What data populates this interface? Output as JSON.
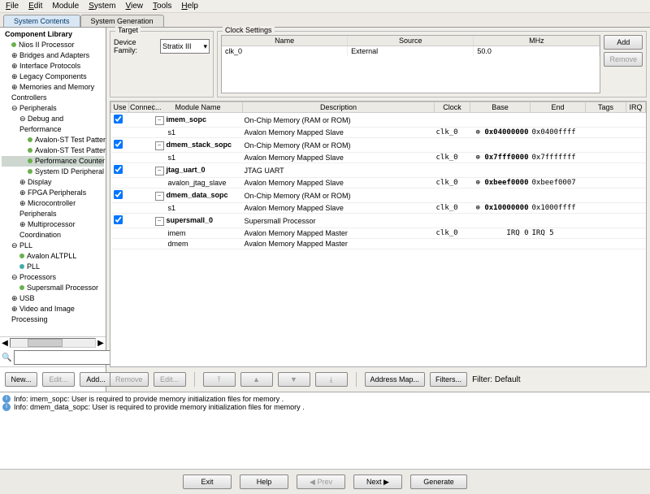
{
  "menu": {
    "file": "File",
    "edit": "Edit",
    "module": "Module",
    "system": "System",
    "view": "View",
    "tools": "Tools",
    "help": "Help"
  },
  "tabs": {
    "contents": "System Contents",
    "generation": "System Generation"
  },
  "target": {
    "legend": "Target",
    "label": "Device Family:",
    "value": "Stratix III"
  },
  "clock": {
    "legend": "Clock Settings",
    "hdr_name": "Name",
    "hdr_source": "Source",
    "hdr_mhz": "MHz",
    "row": {
      "name": "clk_0",
      "source": "External",
      "mhz": "50.0"
    },
    "add": "Add",
    "remove": "Remove"
  },
  "tree": {
    "lib": "Component Library",
    "items": [
      "Nios II Processor",
      "Bridges and Adapters",
      "Interface Protocols",
      "Legacy Components",
      "Memories and Memory Controllers",
      "Peripherals",
      "Debug and Performance",
      "Avalon-ST Test Pattern",
      "Avalon-ST Test Pattern",
      "Performance Counter",
      "System ID Peripheral",
      "Display",
      "FPGA Peripherals",
      "Microcontroller Peripherals",
      "Multiprocessor Coordination",
      "PLL",
      "Avalon ALTPLL",
      "PLL",
      "Processors",
      "Supersmall Processor",
      "USB",
      "Video and Image Processing"
    ]
  },
  "left_btns": {
    "new": "New...",
    "edit": "Edit...",
    "add": "Add..."
  },
  "cols": {
    "use": "Use",
    "conn": "Connec...",
    "module": "Module Name",
    "desc": "Description",
    "clock": "Clock",
    "base": "Base",
    "end": "End",
    "tags": "Tags",
    "irq": "IRQ"
  },
  "rows": [
    {
      "use": true,
      "name": "imem_sopc",
      "desc": "On-Chip Memory (RAM or ROM)",
      "clock": "",
      "base": "",
      "end": ""
    },
    {
      "child": true,
      "name": "s1",
      "desc": "Avalon Memory Mapped Slave",
      "clock": "clk_0",
      "base": "0x04000000",
      "end": "0x0400ffff"
    },
    {
      "use": true,
      "name": "dmem_stack_sopc",
      "desc": "On-Chip Memory (RAM or ROM)",
      "clock": "",
      "base": "",
      "end": ""
    },
    {
      "child": true,
      "name": "s1",
      "desc": "Avalon Memory Mapped Slave",
      "clock": "clk_0",
      "base": "0x7fff0000",
      "end": "0x7fffffff"
    },
    {
      "use": true,
      "name": "jtag_uart_0",
      "desc": "JTAG UART",
      "clock": "",
      "base": "",
      "end": ""
    },
    {
      "child": true,
      "name": "avalon_jtag_slave",
      "desc": "Avalon Memory Mapped Slave",
      "clock": "clk_0",
      "base": "0xbeef0000",
      "end": "0xbeef0007"
    },
    {
      "use": true,
      "name": "dmem_data_sopc",
      "desc": "On-Chip Memory (RAM or ROM)",
      "clock": "",
      "base": "",
      "end": ""
    },
    {
      "child": true,
      "name": "s1",
      "desc": "Avalon Memory Mapped Slave",
      "clock": "clk_0",
      "base": "0x10000000",
      "end": "0x1000ffff"
    },
    {
      "use": true,
      "name": "supersmall_0",
      "desc": "Supersmall Processor",
      "clock": "",
      "base": "",
      "end": ""
    },
    {
      "child": true,
      "name": "imem",
      "desc": "Avalon Memory Mapped Master",
      "clock": "clk_0",
      "base": "IRQ 0",
      "end": "IRQ 5"
    },
    {
      "child": true,
      "name": "dmem",
      "desc": "Avalon Memory Mapped Master",
      "clock": "",
      "base": "",
      "end": ""
    }
  ],
  "toolbar": {
    "remove": "Remove",
    "edit": "Edit...",
    "up": "▲",
    "down": "▼",
    "top": "▲̅",
    "bot": "▼̲",
    "addrmap": "Address Map...",
    "filters": "Filters...",
    "filter_label": "Filter: Default"
  },
  "msgs": [
    "Info: imem_sopc: User is required to provide memory initialization files for memory .",
    "Info: dmem_data_sopc: User is required to provide memory initialization files for memory ."
  ],
  "bottom": {
    "exit": "Exit",
    "help": "Help",
    "prev": "◀ Prev",
    "next": "Next ▶",
    "generate": "Generate"
  }
}
